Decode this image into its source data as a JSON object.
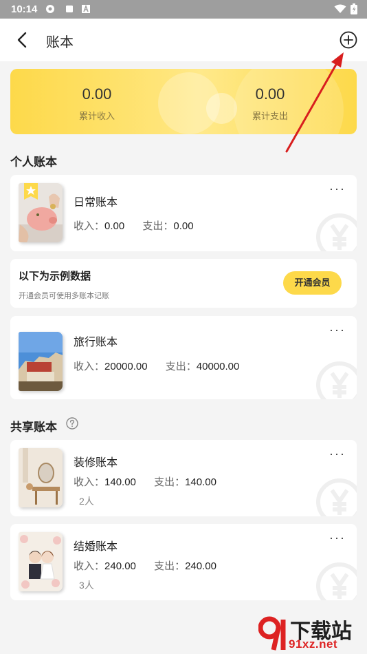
{
  "status_bar": {
    "time": "10:14"
  },
  "header": {
    "title": "账本"
  },
  "summary": {
    "income_value": "0.00",
    "income_label": "累计收入",
    "expense_value": "0.00",
    "expense_label": "累计支出"
  },
  "personal": {
    "title": "个人账本",
    "books": [
      {
        "name": "日常账本",
        "income_label": "收入：",
        "income": "0.00",
        "expense_label": "支出：",
        "expense": "0.00"
      }
    ],
    "sample_notice": {
      "title": "以下为示例数据",
      "subtitle": "开通会员可使用多账本记账",
      "button": "开通会员"
    },
    "sample_books": [
      {
        "name": "旅行账本",
        "income_label": "收入：",
        "income": "20000.00",
        "expense_label": "支出：",
        "expense": "40000.00"
      }
    ]
  },
  "shared": {
    "title": "共享账本",
    "help_icon": "question-icon",
    "books": [
      {
        "name": "装修账本",
        "income_label": "收入：",
        "income": "140.00",
        "expense_label": "支出：",
        "expense": "140.00",
        "members": "2人"
      },
      {
        "name": "结婚账本",
        "income_label": "收入：",
        "income": "240.00",
        "expense_label": "支出：",
        "expense": "240.00",
        "members": "3人"
      }
    ]
  },
  "more_label": "···",
  "site_watermark": {
    "text": "下载站",
    "url_text": "91xz.net"
  },
  "colors": {
    "accent": "#fdd94a",
    "annotation_arrow": "#d81e1e"
  }
}
